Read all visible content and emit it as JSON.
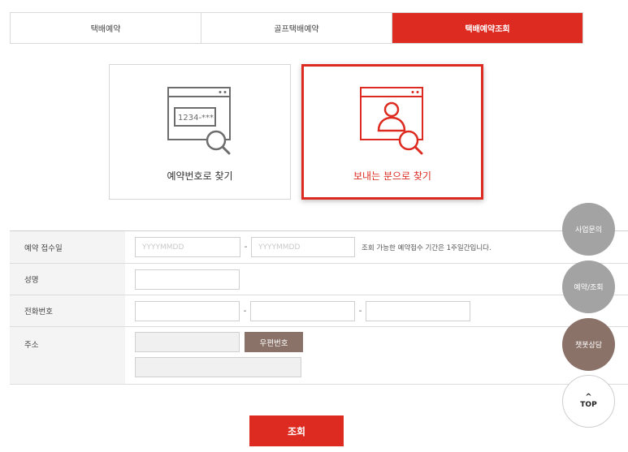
{
  "tabs": [
    {
      "label": "택배예약"
    },
    {
      "label": "골프택배예약"
    },
    {
      "label": "택배예약조회"
    }
  ],
  "cards": {
    "by_number": {
      "label": "예약번호로 찾기",
      "icon_text": "1234-***",
      "icon": "window-number-search-icon"
    },
    "by_sender": {
      "label": "보내는 분으로 찾기",
      "icon": "window-user-search-icon"
    }
  },
  "form": {
    "date": {
      "label": "예약 접수일",
      "from_placeholder": "YYYYMMDD",
      "to_placeholder": "YYYYMMDD",
      "separator": "-",
      "note": "조회 가능한 예약접수 기간은 1주일간입니다."
    },
    "name": {
      "label": "성명"
    },
    "phone": {
      "label": "전화번호",
      "separator": "-"
    },
    "address": {
      "label": "주소",
      "zip_button": "우편번호"
    }
  },
  "submit_label": "조회",
  "floating": {
    "business": "사업문의",
    "reservation": "예약/조회",
    "chatbot": "챗봇상담",
    "top_arrow": "^",
    "top": "TOP"
  },
  "colors": {
    "accent": "#dd2b21",
    "brown": "#8a7268",
    "gray_button": "#a3a3a3"
  }
}
